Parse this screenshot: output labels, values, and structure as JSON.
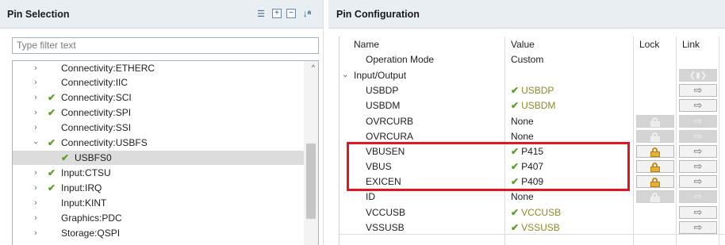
{
  "left_panel": {
    "title": "Pin Selection",
    "filter_placeholder": "Type filter text",
    "tree": [
      {
        "label": "Connectivity:ETHERC",
        "checked": false,
        "expanded": false
      },
      {
        "label": "Connectivity:IIC",
        "checked": false,
        "expanded": false
      },
      {
        "label": "Connectivity:SCI",
        "checked": true,
        "expanded": false
      },
      {
        "label": "Connectivity:SPI",
        "checked": true,
        "expanded": false
      },
      {
        "label": "Connectivity:SSI",
        "checked": false,
        "expanded": false
      },
      {
        "label": "Connectivity:USBFS",
        "checked": true,
        "expanded": true
      },
      {
        "label": "USBFS0",
        "checked": true,
        "child": true,
        "selected": true
      },
      {
        "label": "Input:CTSU",
        "checked": true,
        "expanded": false
      },
      {
        "label": "Input:IRQ",
        "checked": true,
        "expanded": false
      },
      {
        "label": "Input:KINT",
        "checked": false,
        "expanded": false
      },
      {
        "label": "Graphics:PDC",
        "checked": false,
        "expanded": false
      },
      {
        "label": "Storage:QSPI",
        "checked": false,
        "expanded": false
      }
    ]
  },
  "right_panel": {
    "title": "Pin Configuration",
    "columns": {
      "name": "Name",
      "value": "Value",
      "lock": "Lock",
      "link": "Link"
    },
    "rows": [
      {
        "name": "Operation Mode",
        "value": "Custom"
      },
      {
        "name": "Input/Output",
        "value": ""
      },
      {
        "name": "USBDP",
        "value": "USBDP"
      },
      {
        "name": "USBDM",
        "value": "USBDM"
      },
      {
        "name": "OVRCURB",
        "value": "None"
      },
      {
        "name": "OVRCURA",
        "value": "None"
      },
      {
        "name": "VBUSEN",
        "value": "P415"
      },
      {
        "name": "VBUS",
        "value": "P407"
      },
      {
        "name": "EXICEN",
        "value": "P409"
      },
      {
        "name": "ID",
        "value": "None"
      },
      {
        "name": "VCCUSB",
        "value": "VCCUSB"
      },
      {
        "name": "VSSUSB",
        "value": "VSSUSB"
      }
    ]
  },
  "colors": {
    "highlight": "#e0151f",
    "check": "#5a9e2a",
    "pin_value": "#8a8a2a",
    "lock": "#e5b03a"
  }
}
